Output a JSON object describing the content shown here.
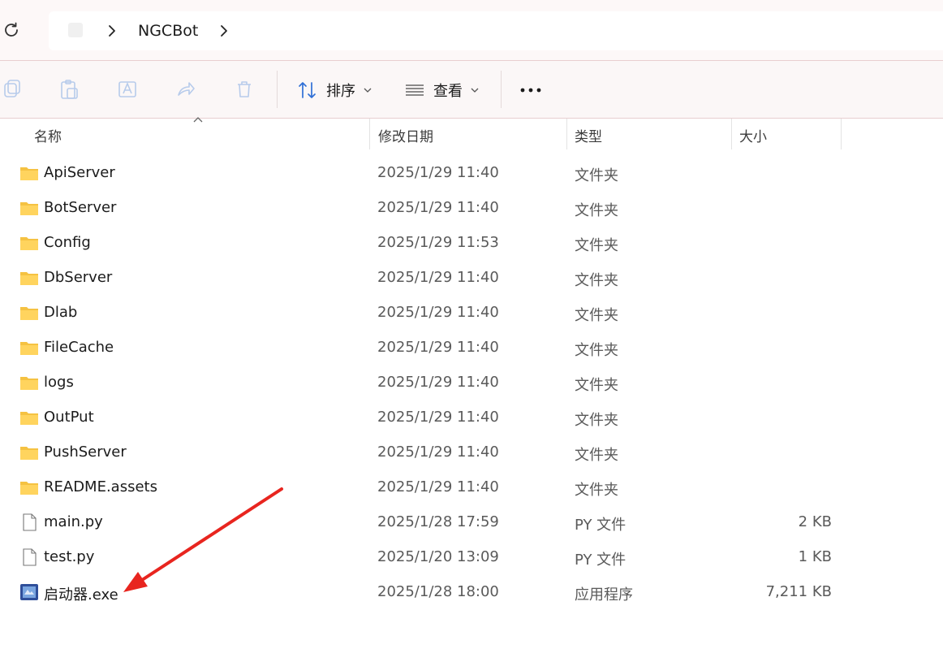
{
  "address": {
    "refresh_icon": "refresh-icon",
    "home_icon": "home-icon",
    "breadcrumb": [
      "NGCBot"
    ],
    "separator_icon": "chevron-right-icon"
  },
  "toolbar": {
    "icons": [
      "copy-icon",
      "paste-icon",
      "rename-icon",
      "share-icon",
      "delete-icon"
    ],
    "sort_label": "排序",
    "view_label": "查看",
    "more_icon": "more-icon"
  },
  "columns": {
    "name": "名称",
    "date": "修改日期",
    "type": "类型",
    "size": "大小"
  },
  "files": [
    {
      "name": "ApiServer",
      "date": "2025/1/29 11:40",
      "type": "文件夹",
      "size": "",
      "icon": "folder-icon"
    },
    {
      "name": "BotServer",
      "date": "2025/1/29 11:40",
      "type": "文件夹",
      "size": "",
      "icon": "folder-icon"
    },
    {
      "name": "Config",
      "date": "2025/1/29 11:53",
      "type": "文件夹",
      "size": "",
      "icon": "folder-icon"
    },
    {
      "name": "DbServer",
      "date": "2025/1/29 11:40",
      "type": "文件夹",
      "size": "",
      "icon": "folder-icon"
    },
    {
      "name": "Dlab",
      "date": "2025/1/29 11:40",
      "type": "文件夹",
      "size": "",
      "icon": "folder-icon"
    },
    {
      "name": "FileCache",
      "date": "2025/1/29 11:40",
      "type": "文件夹",
      "size": "",
      "icon": "folder-icon"
    },
    {
      "name": "logs",
      "date": "2025/1/29 11:40",
      "type": "文件夹",
      "size": "",
      "icon": "folder-icon"
    },
    {
      "name": "OutPut",
      "date": "2025/1/29 11:40",
      "type": "文件夹",
      "size": "",
      "icon": "folder-icon"
    },
    {
      "name": "PushServer",
      "date": "2025/1/29 11:40",
      "type": "文件夹",
      "size": "",
      "icon": "folder-icon"
    },
    {
      "name": "README.assets",
      "date": "2025/1/29 11:40",
      "type": "文件夹",
      "size": "",
      "icon": "folder-icon"
    },
    {
      "name": "main.py",
      "date": "2025/1/28 17:59",
      "type": "PY 文件",
      "size": "2 KB",
      "icon": "file-icon"
    },
    {
      "name": "test.py",
      "date": "2025/1/20 13:09",
      "type": "PY 文件",
      "size": "1 KB",
      "icon": "file-icon"
    },
    {
      "name": "启动器.exe",
      "date": "2025/1/28 18:00",
      "type": "应用程序",
      "size": "7,211 KB",
      "icon": "exe-icon"
    }
  ],
  "annotation": {
    "icon": "red-arrow-annotation",
    "color": "#e8251f"
  },
  "colors": {
    "folder": "#f5c242",
    "accent_border": "#e8cfd0"
  }
}
